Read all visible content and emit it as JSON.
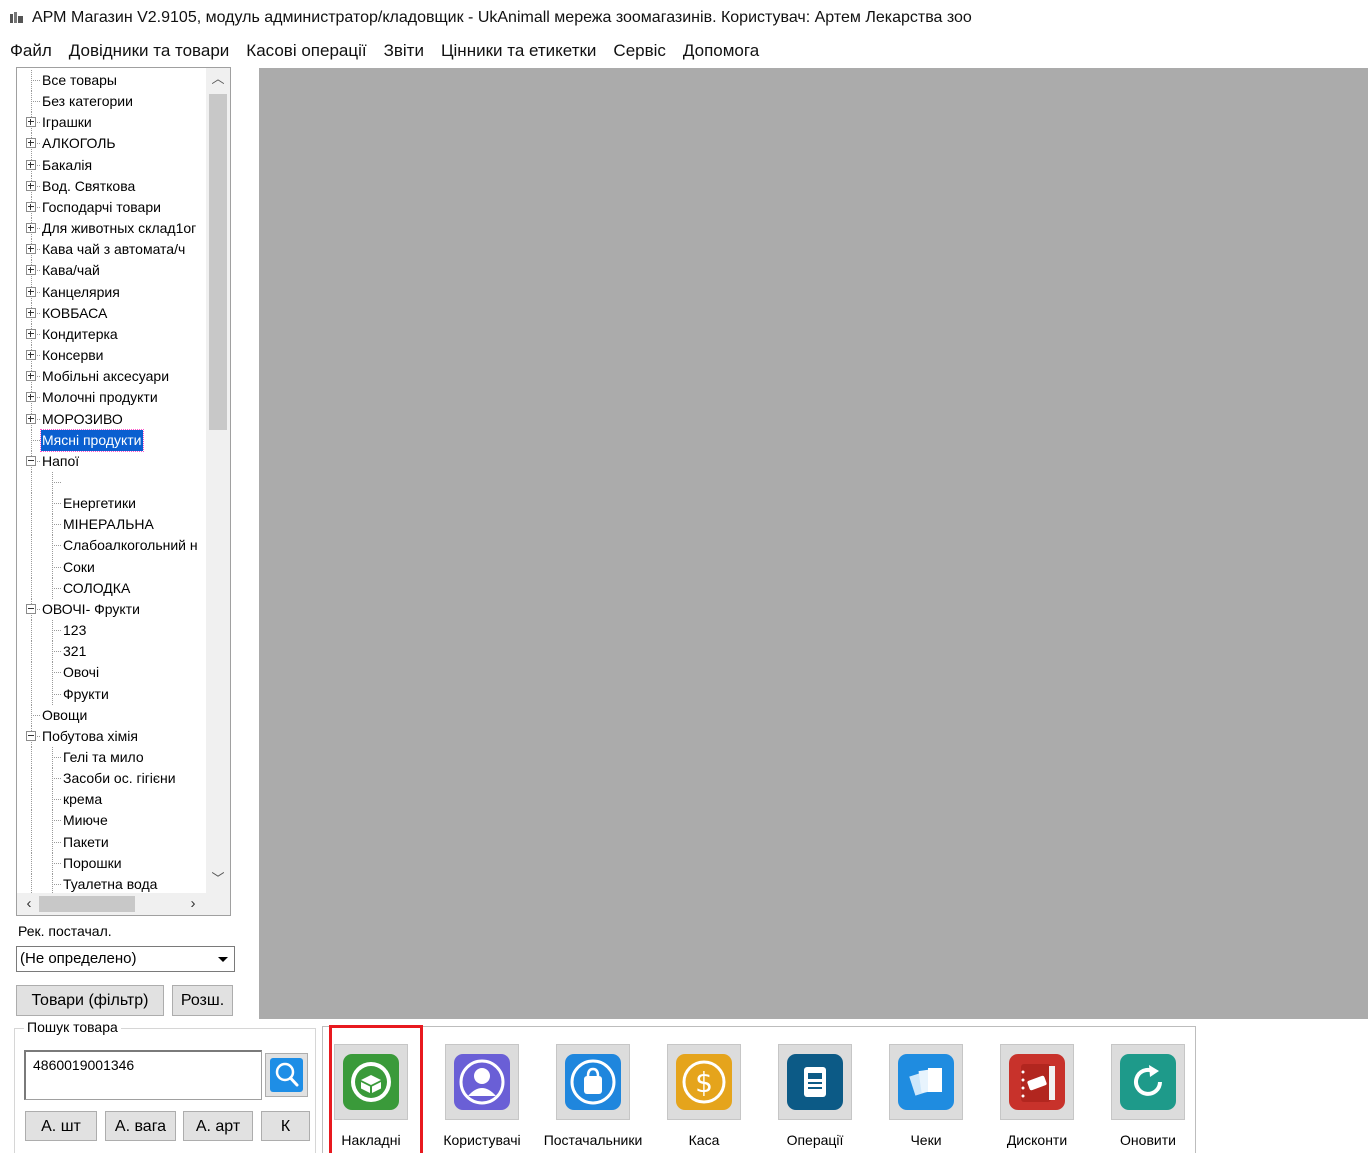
{
  "window": {
    "title": "АРМ Магазин V2.9105, модуль администратор/кладовщик - UkAnimall мережа зоомагазинів. Користувач: Артем Лекарства зоо"
  },
  "menu": [
    "Файл",
    "Довідники та товари",
    "Касові операції",
    "Звіти",
    "Цінники та етикетки",
    "Сервіс",
    "Допомога"
  ],
  "tree": {
    "items": [
      {
        "label": "Все товары",
        "level": 0,
        "expander": "none"
      },
      {
        "label": "Без категории",
        "level": 0,
        "expander": "none"
      },
      {
        "label": "Іграшки",
        "level": 0,
        "expander": "plus"
      },
      {
        "label": "АЛКОГОЛЬ",
        "level": 0,
        "expander": "plus"
      },
      {
        "label": "Бакалія",
        "level": 0,
        "expander": "plus"
      },
      {
        "label": "Вод. Святкова",
        "level": 0,
        "expander": "plus"
      },
      {
        "label": "Господарчі товари",
        "level": 0,
        "expander": "plus"
      },
      {
        "label": "Для животных склад1ог",
        "level": 0,
        "expander": "plus"
      },
      {
        "label": "Кава  чай з автомата/ч",
        "level": 0,
        "expander": "plus"
      },
      {
        "label": "Кава/чай",
        "level": 0,
        "expander": "plus"
      },
      {
        "label": "Канцелярия",
        "level": 0,
        "expander": "plus"
      },
      {
        "label": "КОВБАСА",
        "level": 0,
        "expander": "plus"
      },
      {
        "label": "Кондитерка",
        "level": 0,
        "expander": "plus"
      },
      {
        "label": "Консерви",
        "level": 0,
        "expander": "plus"
      },
      {
        "label": "Мобільні аксесуари",
        "level": 0,
        "expander": "plus"
      },
      {
        "label": "Молочні продукти",
        "level": 0,
        "expander": "plus"
      },
      {
        "label": "МОРОЗИВО",
        "level": 0,
        "expander": "plus"
      },
      {
        "label": "Мясні продукти",
        "level": 0,
        "expander": "none",
        "selected": true
      },
      {
        "label": "Напої",
        "level": 0,
        "expander": "minus"
      },
      {
        "label": "",
        "level": 1,
        "expander": "none"
      },
      {
        "label": "Енергетики",
        "level": 1,
        "expander": "none"
      },
      {
        "label": "МІНЕРАЛЬНА",
        "level": 1,
        "expander": "none"
      },
      {
        "label": "Слабоалкогольний н",
        "level": 1,
        "expander": "none"
      },
      {
        "label": "Соки",
        "level": 1,
        "expander": "none"
      },
      {
        "label": "СОЛОДКА",
        "level": 1,
        "expander": "none"
      },
      {
        "label": "ОВОЧІ- Фрукти",
        "level": 0,
        "expander": "minus"
      },
      {
        "label": "123",
        "level": 1,
        "expander": "none"
      },
      {
        "label": "321",
        "level": 1,
        "expander": "none"
      },
      {
        "label": "Овочі",
        "level": 1,
        "expander": "none"
      },
      {
        "label": "Фрукти",
        "level": 1,
        "expander": "none"
      },
      {
        "label": "Овощи",
        "level": 0,
        "expander": "none"
      },
      {
        "label": "Побутова хімія",
        "level": 0,
        "expander": "minus"
      },
      {
        "label": "Гелі та мило",
        "level": 1,
        "expander": "none"
      },
      {
        "label": "Засоби ос. гігієни",
        "level": 1,
        "expander": "none"
      },
      {
        "label": "крема",
        "level": 1,
        "expander": "none"
      },
      {
        "label": "Миюче",
        "level": 1,
        "expander": "none"
      },
      {
        "label": "Пакети",
        "level": 1,
        "expander": "none"
      },
      {
        "label": "Порошки",
        "level": 1,
        "expander": "none"
      },
      {
        "label": "Туалетна вода",
        "level": 1,
        "expander": "none"
      }
    ],
    "scroll_position_fraction": 0.0
  },
  "supplier": {
    "label": "Рек. постачал.",
    "selected": "(Не определено)"
  },
  "buttons": {
    "goods_filter": "Товари (фільтр)",
    "expand": "Розш."
  },
  "search": {
    "group_label": "Пошук товара",
    "value": "4860019001346",
    "buttons": [
      "А. шт",
      "А. вага",
      "А. арт",
      "К"
    ]
  },
  "toolbar": {
    "highlighted": "Накладні",
    "tools": [
      {
        "label": "Накладні",
        "icon": "invoice-box-icon",
        "color": "#3a9a3a"
      },
      {
        "label": "Користувачі",
        "icon": "user-icon",
        "color": "#6a5fd6"
      },
      {
        "label": "Постачальники",
        "icon": "shopping-bag-icon",
        "color": "#1f86dd"
      },
      {
        "label": "Каса",
        "icon": "dollar-coin-icon",
        "color": "#e5a41c"
      },
      {
        "label": "Операції",
        "icon": "document-icon",
        "color": "#0c5a86"
      },
      {
        "label": "Чеки",
        "icon": "receipts-icon",
        "color": "#1f8ce0"
      },
      {
        "label": "Дисконти",
        "icon": "discount-book-icon",
        "color": "#c8322b"
      },
      {
        "label": "Оновити",
        "icon": "refresh-icon",
        "color": "#1e9a8a"
      }
    ]
  },
  "colors": {
    "workspace": "#ababab",
    "selection": "#0a5fd0",
    "highlight_frame": "#e8191f"
  }
}
